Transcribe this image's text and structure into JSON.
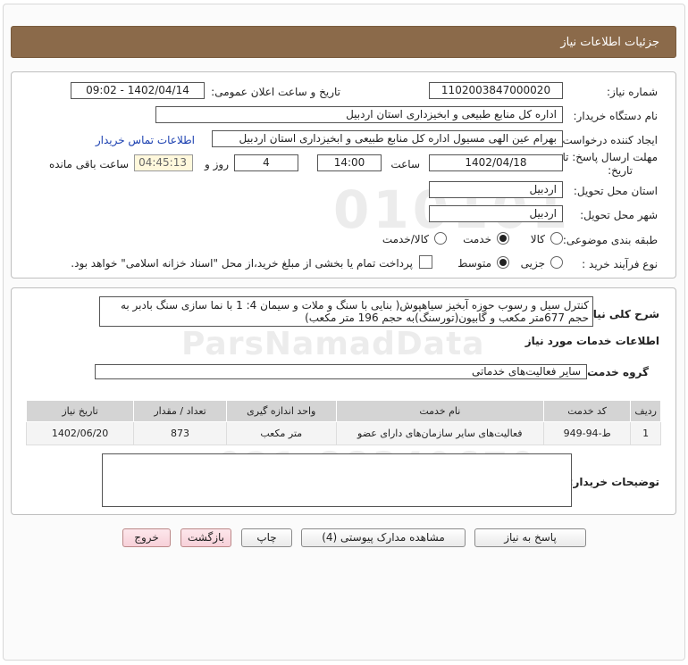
{
  "header": {
    "title": "جزئیات اطلاعات نیاز"
  },
  "info": {
    "need_number_label": "شماره نیاز:",
    "need_number": "1102003847000020",
    "announce_label": "تاریخ و ساعت اعلان عمومی:",
    "announce_value": "1402/04/14 - 09:02",
    "buyer_org_label": "نام دستگاه خریدار:",
    "buyer_org": "اداره کل منابع طبیعی و ابخیزداری استان اردبیل",
    "creator_label": "ایجاد کننده درخواست:",
    "creator": "بهرام عین الهی مسیول اداره کل منابع طبیعی و ابخیزداری استان اردبیل",
    "contact_link": "اطلاعات تماس خریدار",
    "deadline_label_1": "مهلت ارسال پاسخ: تا",
    "deadline_label_2": "تاریخ:",
    "deadline_date": "1402/04/18",
    "time_label": "ساعت",
    "deadline_time": "14:00",
    "days_value": "4",
    "days_label": "روز و",
    "remaining_time": "04:45:13",
    "remaining_label": "ساعت باقی مانده",
    "province_label": "استان محل تحویل:",
    "province": "اردبیل",
    "city_label": "شهر محل تحویل:",
    "city": "اردبیل",
    "category_label": "طبقه بندی موضوعی:",
    "category_options": [
      "کالا",
      "خدمت",
      "کالا/خدمت"
    ],
    "process_label": "نوع فرآیند خرید :",
    "process_options": [
      "جزیی",
      "متوسط"
    ],
    "payment_note": "پرداخت تمام یا بخشی از مبلغ خرید،از محل \"اسناد خزانه اسلامی\" خواهد بود."
  },
  "general": {
    "description_label": "شرح کلی نیاز:",
    "description": "کنترل سیل و رسوب حوزه آبخیز سیاهپوش( بنایی با سنگ و ملات و سیمان 4: 1 با نما سازی سنگ بادبر به حجم 677متر مکعب و گابیون(تورسنگ)به حجم 196 متر مکعب)",
    "services_title": "اطلاعات خدمات مورد نیاز",
    "service_group_label": "گروه خدمت:",
    "service_group": "سایر فعالیت‌های خدماتی",
    "table": {
      "headers": [
        "ردیف",
        "کد خدمت",
        "نام خدمت",
        "واحد اندازه گیری",
        "تعداد / مقدار",
        "تاریخ نیاز"
      ],
      "rows": [
        [
          "1",
          "ط-94-949",
          "فعالیت‌های سایر سازمان‌های دارای عضو",
          "متر مکعب",
          "873",
          "1402/06/20"
        ]
      ]
    },
    "buyer_notes_label": "توضیحات خریدار:",
    "buyer_notes": ""
  },
  "buttons": {
    "reply": "پاسخ به نیاز",
    "attachments": "مشاهده مدارک پیوستی (4)",
    "print": "چاپ",
    "back": "بازگشت",
    "exit": "خروج"
  }
}
